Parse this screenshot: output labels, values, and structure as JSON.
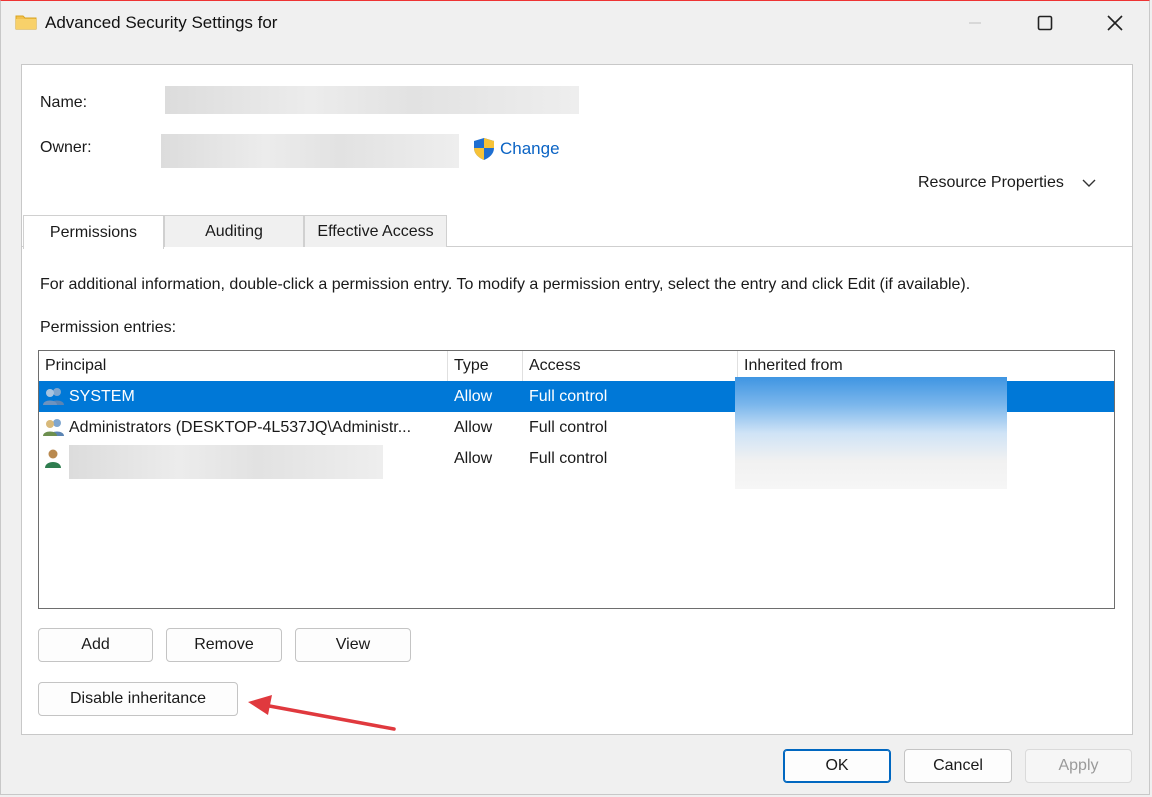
{
  "window": {
    "title": "Advanced Security Settings for",
    "controls": {
      "minimize": "minimize",
      "maximize": "maximize",
      "close": "close"
    }
  },
  "header": {
    "name_label": "Name:",
    "owner_label": "Owner:",
    "change_link": "Change",
    "resource_properties": "Resource Properties"
  },
  "tabs": [
    {
      "label": "Permissions",
      "active": true
    },
    {
      "label": "Auditing",
      "active": false
    },
    {
      "label": "Effective Access",
      "active": false
    }
  ],
  "permissions": {
    "info_text": "For additional information, double-click a permission entry. To modify a permission entry, select the entry and click Edit (if available).",
    "entries_label": "Permission entries:",
    "columns": [
      "Principal",
      "Type",
      "Access",
      "Inherited from"
    ],
    "rows": [
      {
        "principal": "SYSTEM",
        "type": "Allow",
        "access": "Full control",
        "icon": "group-users-icon",
        "selected": true
      },
      {
        "principal": "Administrators (DESKTOP-4L537JQ\\Administr...",
        "type": "Allow",
        "access": "Full control",
        "icon": "group-users-icon",
        "selected": false
      },
      {
        "principal": "",
        "type": "Allow",
        "access": "Full control",
        "icon": "user-icon",
        "selected": false
      }
    ]
  },
  "buttons": {
    "add": "Add",
    "remove": "Remove",
    "view": "View",
    "disable_inheritance": "Disable inheritance",
    "ok": "OK",
    "cancel": "Cancel",
    "apply": "Apply"
  },
  "colors": {
    "selection": "#0078d7",
    "link": "#0a63c4",
    "annotation_arrow": "#e0393e"
  }
}
